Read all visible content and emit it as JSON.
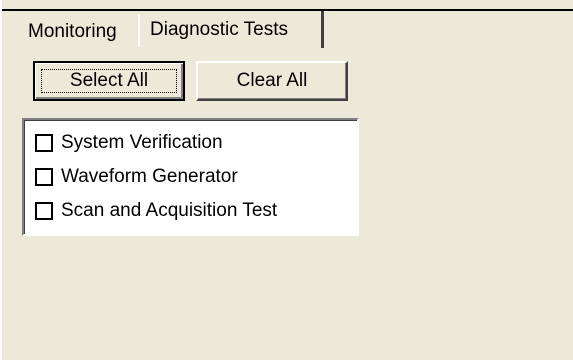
{
  "tabs": [
    {
      "label": "Monitoring",
      "selected": false
    },
    {
      "label": "Diagnostic Tests",
      "selected": true
    }
  ],
  "buttons": {
    "select_all": "Select All",
    "clear_all": "Clear All"
  },
  "tests": [
    {
      "label": "System Verification",
      "checked": false
    },
    {
      "label": "Waveform Generator",
      "checked": false
    },
    {
      "label": "Scan and Acquisition Test",
      "checked": false
    }
  ],
  "colors": {
    "panel_background": "#ece9d8",
    "list_background": "#ffffff"
  }
}
